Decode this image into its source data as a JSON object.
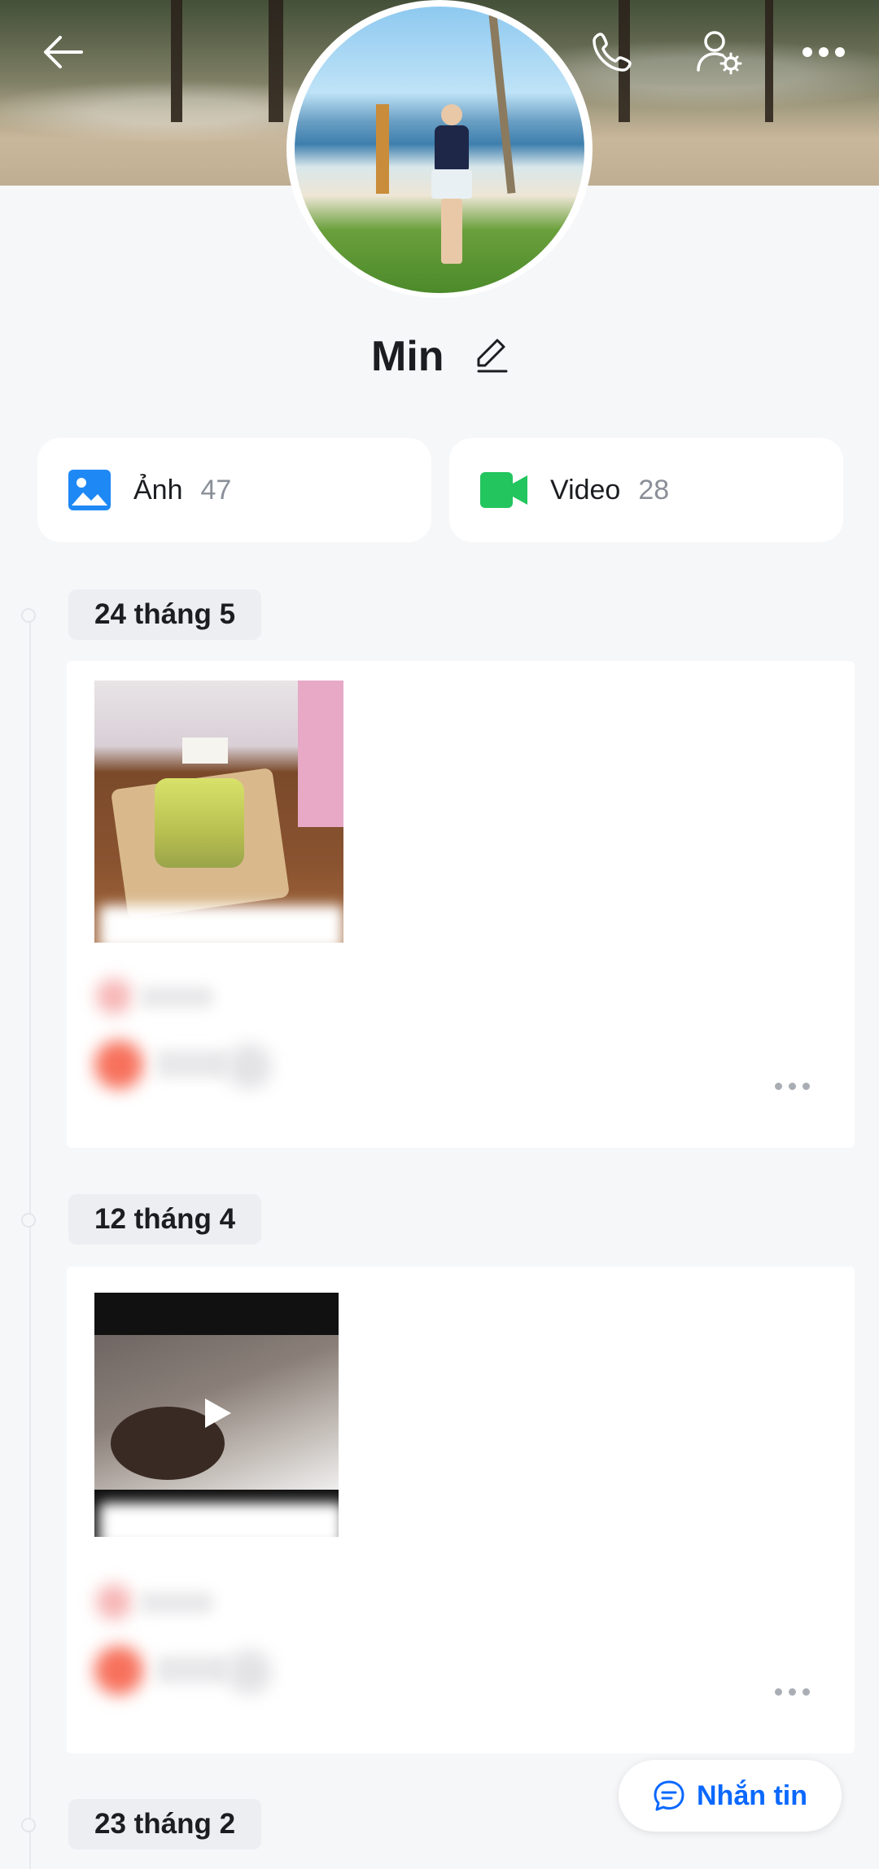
{
  "header": {
    "back_icon": "arrow-left-icon",
    "call_icon": "phone-icon",
    "settings_icon": "user-settings-icon",
    "more_icon": "more-horizontal-icon"
  },
  "profile": {
    "name": "Min",
    "edit_icon": "pencil-icon"
  },
  "stats": [
    {
      "label": "Ảnh",
      "count": "47",
      "icon": "image-icon",
      "color": "#1e88f5"
    },
    {
      "label": "Video",
      "count": "28",
      "icon": "video-camera-icon",
      "color": "#22c55e"
    }
  ],
  "timeline": [
    {
      "date": "24 tháng 5",
      "media": "photo"
    },
    {
      "date": "12 tháng 4",
      "media": "video"
    },
    {
      "date": "23 tháng 2"
    }
  ],
  "actions": {
    "message_label": "Nhắn tin",
    "message_icon": "chat-bubble-icon",
    "accent": "#0a68ff"
  }
}
